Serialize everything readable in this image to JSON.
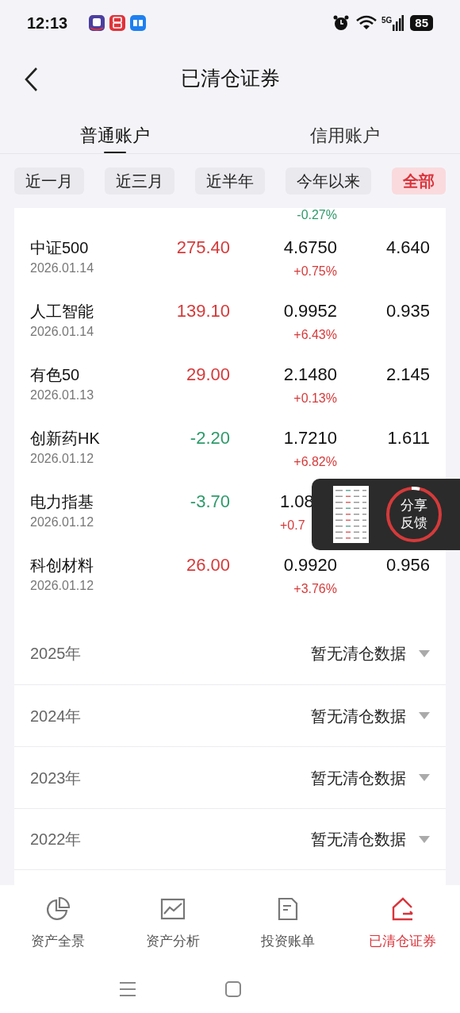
{
  "status_bar": {
    "time": "12:13",
    "network": "5G",
    "battery": "85"
  },
  "header": {
    "title": "已清仓证券"
  },
  "account_tabs": [
    {
      "label": "普通账户",
      "selected": true
    },
    {
      "label": "信用账户",
      "selected": false
    }
  ],
  "filters": [
    {
      "label": "近一月",
      "selected": false
    },
    {
      "label": "近三月",
      "selected": false
    },
    {
      "label": "近半年",
      "selected": false
    },
    {
      "label": "今年以来",
      "selected": false
    },
    {
      "label": "全部",
      "selected": true
    }
  ],
  "rows": [
    {
      "change": "-0.27%",
      "change_negative": true
    },
    {
      "name": "中证500",
      "date": "2026.01.14",
      "value": "275.40",
      "value_negative": false,
      "price": "4.6750",
      "change": "+0.75%",
      "change_negative": false,
      "last": "4.640"
    },
    {
      "name": "人工智能",
      "date": "2026.01.14",
      "value": "139.10",
      "value_negative": false,
      "price": "0.9952",
      "change": "+6.43%",
      "change_negative": false,
      "last": "0.935"
    },
    {
      "name": "有色50",
      "date": "2026.01.13",
      "value": "29.00",
      "value_negative": false,
      "price": "2.1480",
      "change": "+0.13%",
      "change_negative": false,
      "last": "2.145"
    },
    {
      "name": "创新药HK",
      "date": "2026.01.12",
      "value": "-2.20",
      "value_negative": true,
      "price": "1.7210",
      "change": "+6.82%",
      "change_negative": false,
      "last": "1.611"
    },
    {
      "name": "电力指基",
      "date": "2026.01.12",
      "value": "-3.70",
      "value_negative": true,
      "price": "1.08",
      "change": "+0.7",
      "change_negative": false,
      "covered": true
    },
    {
      "name": "科创材料",
      "date": "2026.01.12",
      "value": "26.00",
      "value_negative": false,
      "price": "0.9920",
      "change": "+3.76%",
      "change_negative": false,
      "last": "0.956"
    }
  ],
  "years": [
    {
      "year": "2025年",
      "status": "暂无清仓数据"
    },
    {
      "year": "2024年",
      "status": "暂无清仓数据"
    },
    {
      "year": "2023年",
      "status": "暂无清仓数据"
    },
    {
      "year": "2022年",
      "status": "暂无清仓数据"
    }
  ],
  "feedback_overlay": {
    "label": "分享反馈"
  },
  "bottom_nav": [
    {
      "label": "资产全景",
      "selected": false
    },
    {
      "label": "资产分析",
      "selected": false
    },
    {
      "label": "投资账单",
      "selected": false
    },
    {
      "label": "已清仓证券",
      "selected": true
    }
  ]
}
